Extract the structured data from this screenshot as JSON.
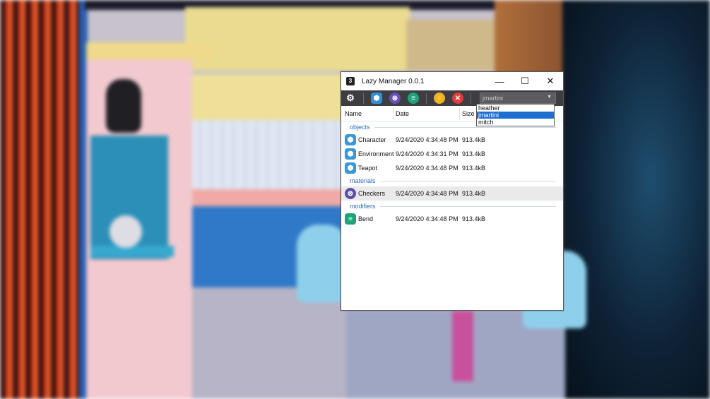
{
  "window": {
    "title": "Lazy Manager 0.0.1",
    "app_icon_glyph": "3",
    "minimize_glyph": "—",
    "maximize_glyph": "☐",
    "close_glyph": "✕"
  },
  "toolbar": {
    "buttons": [
      {
        "name": "settings",
        "icon": "gear-icon",
        "glyph": "⚙",
        "color": "#3e3e42"
      },
      {
        "name": "objects",
        "icon": "cube-icon",
        "glyph": "⬢",
        "color": "#2f8fd8"
      },
      {
        "name": "materials",
        "icon": "checker-sphere-icon",
        "glyph": "⊗",
        "color": "#6a4fb8"
      },
      {
        "name": "modifiers",
        "icon": "list-icon",
        "glyph": "≡",
        "color": "#1fa37a"
      },
      {
        "name": "lightning",
        "icon": "lightning-icon",
        "glyph": "⚡",
        "color": "#f0b223"
      },
      {
        "name": "delete",
        "icon": "close-circle-icon",
        "glyph": "✕",
        "color": "#e23b3b"
      }
    ],
    "user_select": {
      "value": "jmartini",
      "caret": "▼"
    }
  },
  "user_dropdown": {
    "options": [
      "heather",
      "jmartini",
      "mitch"
    ],
    "selected": "jmartini"
  },
  "table": {
    "columns": {
      "name": "Name",
      "date": "Date",
      "size": "Size"
    },
    "groups": [
      {
        "label": "objects",
        "icon": "cube-icon",
        "glyph": "⬢",
        "color": "#3b97d8",
        "items": [
          {
            "name": "Character",
            "date": "9/24/2020 4:34:48 PM",
            "size": "913.4kB"
          },
          {
            "name": "Environment",
            "date": "9/24/2020 4:34:31 PM",
            "size": "913.4kB"
          },
          {
            "name": "Teapot",
            "date": "9/24/2020 4:34:48 PM",
            "size": "913.4kB"
          }
        ]
      },
      {
        "label": "materials",
        "icon": "checker-sphere-icon",
        "glyph": "⊗",
        "color": "#5c4fa8",
        "items": [
          {
            "name": "Checkers",
            "date": "9/24/2020 4:34:48 PM",
            "size": "913.4kB",
            "highlighted": true
          }
        ]
      },
      {
        "label": "modifiers",
        "icon": "list-icon",
        "glyph": "≡",
        "color": "#1fa37a",
        "items": [
          {
            "name": "Bend",
            "date": "9/24/2020 4:34:48 PM",
            "size": "913.4kB"
          }
        ]
      }
    ]
  }
}
